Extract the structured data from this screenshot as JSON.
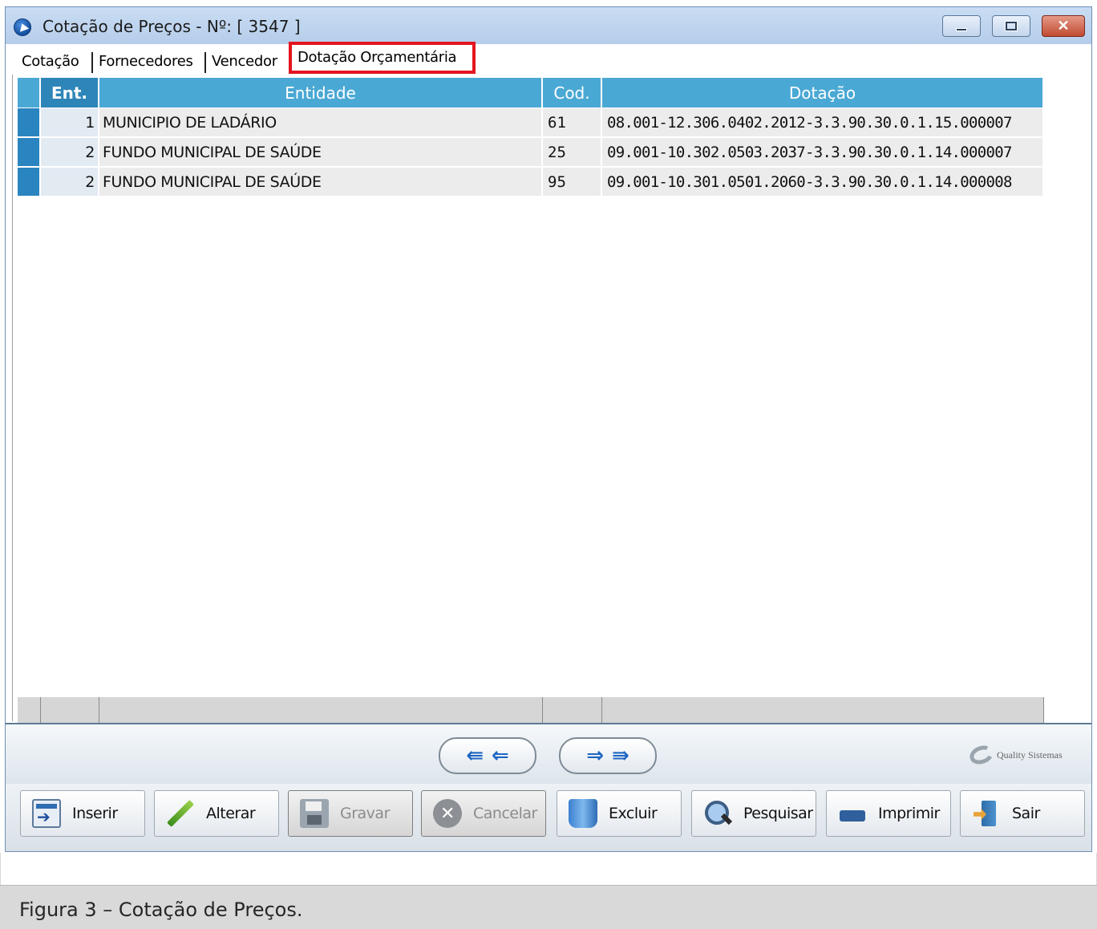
{
  "window": {
    "title": "Cotação de Preços - Nº: [ 3547 ]"
  },
  "tabs": [
    {
      "label": "Cotação"
    },
    {
      "label": "Fornecedores"
    },
    {
      "label": "Vencedor"
    },
    {
      "label": "Dotação Orçamentária",
      "active": true
    }
  ],
  "grid": {
    "headers": {
      "ent": "Ent.",
      "entidade": "Entidade",
      "cod": "Cod.",
      "dotacao": "Dotação"
    },
    "rows": [
      {
        "ent": "1",
        "entidade": "MUNICIPIO DE LADÁRIO",
        "cod": "61",
        "dotacao": "08.001-12.306.0402.2012-3.3.90.30.0.1.15.000007"
      },
      {
        "ent": "2",
        "entidade": "FUNDO MUNICIPAL DE SAÚDE",
        "cod": "25",
        "dotacao": "09.001-10.302.0503.2037-3.3.90.30.0.1.14.000007"
      },
      {
        "ent": "2",
        "entidade": "FUNDO MUNICIPAL DE SAÚDE",
        "cod": "95",
        "dotacao": "09.001-10.301.0501.2060-3.3.90.30.0.1.14.000008"
      }
    ]
  },
  "navigation": {
    "first": "⇚",
    "prev": "⇐",
    "next": "⇒",
    "last": "⇛"
  },
  "logo": {
    "text": "Quality Sistemas"
  },
  "buttons": {
    "inserir": "Inserir",
    "alterar": "Alterar",
    "gravar": "Gravar",
    "cancelar": "Cancelar",
    "excluir": "Excluir",
    "pesquisar": "Pesquisar",
    "imprimir": "Imprimir",
    "sair": "Sair"
  },
  "caption": "Figura 3 – Cotação de Preços.",
  "colors": {
    "header": "#4aa8d4",
    "header_active": "#2e86b8",
    "highlight_box": "#e3151f",
    "indicator": "#2a84bf"
  }
}
